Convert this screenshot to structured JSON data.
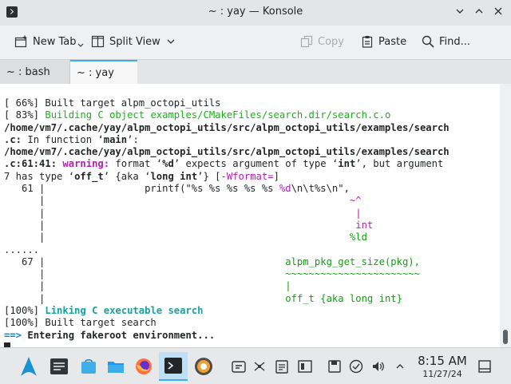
{
  "window": {
    "title": "~ : yay — Konsole"
  },
  "toolbar": {
    "new_tab": "New Tab",
    "split_view": "Split View",
    "copy": "Copy",
    "paste": "Paste",
    "find": "Find..."
  },
  "tabs": [
    {
      "label": "~ : bash"
    },
    {
      "label": "~ : yay"
    }
  ],
  "terminal": {
    "lines": [
      [
        {
          "t": "[ 66%] Built target alpm_octopi_utils"
        }
      ],
      [
        {
          "t": "[ 83%] "
        },
        {
          "t": "Building C object examples/CMakeFiles/search.dir/search.c.o",
          "c": "c-green"
        }
      ],
      [
        {
          "t": "/home/vm7/.cache/yay/alpm_octopi_utils/src/alpm_octopi_utils/examples/search",
          "c": "c-bold"
        }
      ],
      [
        {
          "t": ".c:",
          "c": "c-bold"
        },
        {
          "t": " In function ‘"
        },
        {
          "t": "main",
          "c": "c-bold"
        },
        {
          "t": "’:"
        }
      ],
      [
        {
          "t": "/home/vm7/.cache/yay/alpm_octopi_utils/src/alpm_octopi_utils/examples/search",
          "c": "c-bold"
        }
      ],
      [
        {
          "t": ".c:61:41:",
          "c": "c-bold"
        },
        {
          "t": " "
        },
        {
          "t": "warning:",
          "c": "c-magenta c-bold"
        },
        {
          "t": " format ‘"
        },
        {
          "t": "%d",
          "c": "c-bold"
        },
        {
          "t": "’ expects argument of type ‘"
        },
        {
          "t": "int",
          "c": "c-bold"
        },
        {
          "t": "’, but argument"
        }
      ],
      [
        {
          "t": "7 has type ‘"
        },
        {
          "t": "off_t",
          "c": "c-bold"
        },
        {
          "t": "’ {aka ‘"
        },
        {
          "t": "long int",
          "c": "c-bold"
        },
        {
          "t": "’} ["
        },
        {
          "t": "-Wformat=",
          "c": "c-magenta"
        },
        {
          "t": "]"
        }
      ],
      [
        {
          "t": "   61 |                 printf(\"%s %s %s %s %s "
        },
        {
          "t": "%d",
          "c": "c-magenta"
        },
        {
          "t": "\\n\\t%s\\n\","
        }
      ],
      [
        {
          "t": "      |                                                    "
        },
        {
          "t": "~^",
          "c": "c-magenta"
        }
      ],
      [
        {
          "t": "      |                                                     "
        },
        {
          "t": "|",
          "c": "c-magenta"
        }
      ],
      [
        {
          "t": "      |                                                     "
        },
        {
          "t": "int",
          "c": "c-magenta"
        }
      ],
      [
        {
          "t": "      |                                                    "
        },
        {
          "t": "%ld",
          "c": "c-grn2"
        }
      ],
      [
        {
          "t": "......"
        }
      ],
      [
        {
          "t": "   67 |                                         "
        },
        {
          "t": "alpm_pkg_get_size(pkg),",
          "c": "c-grn2"
        }
      ],
      [
        {
          "t": "      |                                         "
        },
        {
          "t": "~~~~~~~~~~~~~~~~~~~~~~~",
          "c": "c-grn2"
        }
      ],
      [
        {
          "t": "      |                                         "
        },
        {
          "t": "|",
          "c": "c-grn2"
        }
      ],
      [
        {
          "t": "      |                                         "
        },
        {
          "t": "off_t {aka long int}",
          "c": "c-grn2"
        }
      ],
      [
        {
          "t": "[100%] "
        },
        {
          "t": "Linking C executable search",
          "c": "c-teal c-bold"
        }
      ],
      [
        {
          "t": "[100%] Built target search"
        }
      ],
      [
        {
          "t": "==>",
          "c": "c-blue c-bold"
        },
        {
          "t": " "
        },
        {
          "t": "Entering fakeroot environment...",
          "c": "c-bold"
        }
      ]
    ]
  },
  "taskbar": {
    "time": "8:15 AM",
    "date": "11/27/24"
  },
  "colors": {
    "accent": "#3daee9",
    "terminal_bg": "#ffffff",
    "warning": "#b21fb2",
    "fixit": "#12a012"
  },
  "icons": {
    "launcher": "arch-logo-icon",
    "tasks": [
      "task-manager-icon",
      "discover-store-icon",
      "file-manager-icon",
      "firefox-icon",
      "konsole-icon",
      "octopi-icon"
    ],
    "tray": [
      "clipboard-icon",
      "network-icon",
      "notes-icon",
      "screen-icon",
      "save-icon",
      "update-icon",
      "volume-icon",
      "show-desktop-icon"
    ]
  }
}
